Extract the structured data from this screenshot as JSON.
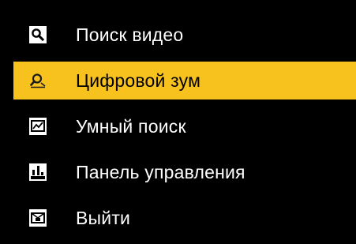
{
  "menu": {
    "items": [
      {
        "label": "Поиск видео",
        "icon": "search-icon",
        "active": false
      },
      {
        "label": "Цифровой зум",
        "icon": "digital-zoom-icon",
        "active": true
      },
      {
        "label": "Умный поиск",
        "icon": "smart-search-icon",
        "active": false
      },
      {
        "label": "Панель управления",
        "icon": "control-panel-icon",
        "active": false
      },
      {
        "label": "Выйти",
        "icon": "exit-icon",
        "active": false
      }
    ]
  },
  "colors": {
    "background": "#000000",
    "highlight": "#f7c21e",
    "text": "#ffffff",
    "active_text": "#000000"
  }
}
